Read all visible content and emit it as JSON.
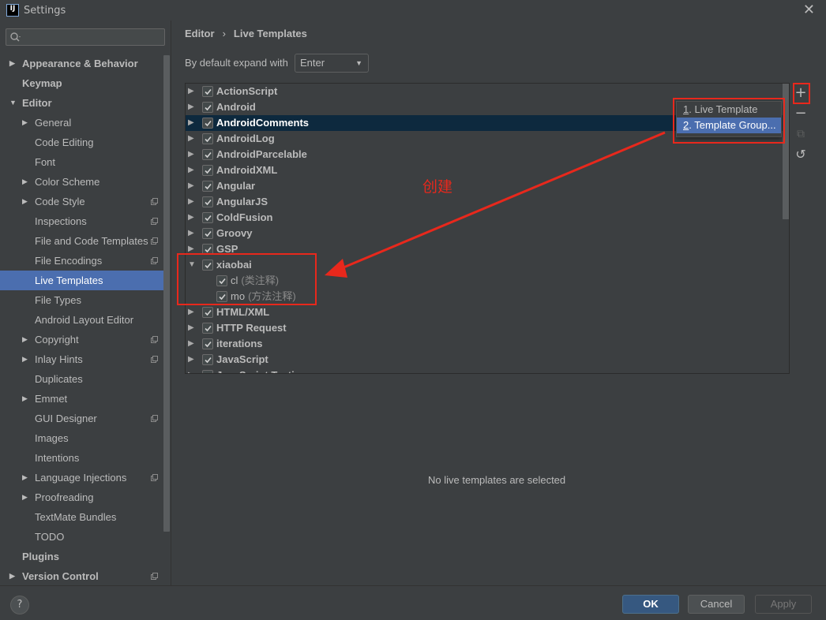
{
  "window": {
    "title": "Settings",
    "logo_text": "IJ"
  },
  "sidebar": {
    "search_placeholder": "",
    "items": [
      {
        "label": "Appearance & Behavior",
        "level": 0,
        "bold": true,
        "arrow": "right",
        "badge": false
      },
      {
        "label": "Keymap",
        "level": 0,
        "bold": true,
        "arrow": "",
        "badge": false
      },
      {
        "label": "Editor",
        "level": 0,
        "bold": true,
        "arrow": "down",
        "badge": false
      },
      {
        "label": "General",
        "level": 1,
        "bold": false,
        "arrow": "right",
        "badge": false
      },
      {
        "label": "Code Editing",
        "level": 1,
        "bold": false,
        "arrow": "",
        "badge": false
      },
      {
        "label": "Font",
        "level": 1,
        "bold": false,
        "arrow": "",
        "badge": false
      },
      {
        "label": "Color Scheme",
        "level": 1,
        "bold": false,
        "arrow": "right",
        "badge": false
      },
      {
        "label": "Code Style",
        "level": 1,
        "bold": false,
        "arrow": "right",
        "badge": true
      },
      {
        "label": "Inspections",
        "level": 1,
        "bold": false,
        "arrow": "",
        "badge": true
      },
      {
        "label": "File and Code Templates",
        "level": 1,
        "bold": false,
        "arrow": "",
        "badge": true
      },
      {
        "label": "File Encodings",
        "level": 1,
        "bold": false,
        "arrow": "",
        "badge": true
      },
      {
        "label": "Live Templates",
        "level": 1,
        "bold": false,
        "arrow": "",
        "badge": false,
        "selected": true
      },
      {
        "label": "File Types",
        "level": 1,
        "bold": false,
        "arrow": "",
        "badge": false
      },
      {
        "label": "Android Layout Editor",
        "level": 1,
        "bold": false,
        "arrow": "",
        "badge": false
      },
      {
        "label": "Copyright",
        "level": 1,
        "bold": false,
        "arrow": "right",
        "badge": true
      },
      {
        "label": "Inlay Hints",
        "level": 1,
        "bold": false,
        "arrow": "right",
        "badge": true
      },
      {
        "label": "Duplicates",
        "level": 1,
        "bold": false,
        "arrow": "",
        "badge": false
      },
      {
        "label": "Emmet",
        "level": 1,
        "bold": false,
        "arrow": "right",
        "badge": false
      },
      {
        "label": "GUI Designer",
        "level": 1,
        "bold": false,
        "arrow": "",
        "badge": true
      },
      {
        "label": "Images",
        "level": 1,
        "bold": false,
        "arrow": "",
        "badge": false
      },
      {
        "label": "Intentions",
        "level": 1,
        "bold": false,
        "arrow": "",
        "badge": false
      },
      {
        "label": "Language Injections",
        "level": 1,
        "bold": false,
        "arrow": "right",
        "badge": true
      },
      {
        "label": "Proofreading",
        "level": 1,
        "bold": false,
        "arrow": "right",
        "badge": false
      },
      {
        "label": "TextMate Bundles",
        "level": 1,
        "bold": false,
        "arrow": "",
        "badge": false
      },
      {
        "label": "TODO",
        "level": 1,
        "bold": false,
        "arrow": "",
        "badge": false
      },
      {
        "label": "Plugins",
        "level": 0,
        "bold": true,
        "arrow": "",
        "badge": false
      },
      {
        "label": "Version Control",
        "level": 0,
        "bold": true,
        "arrow": "right",
        "badge": true
      }
    ]
  },
  "breadcrumb": {
    "parent": "Editor",
    "separator": "›",
    "current": "Live Templates"
  },
  "expand": {
    "label": "By default expand with",
    "value": "Enter"
  },
  "tree": [
    {
      "type": "group",
      "label": "ActionScript",
      "checked": true
    },
    {
      "type": "group",
      "label": "Android",
      "checked": true
    },
    {
      "type": "group",
      "label": "AndroidComments",
      "checked": true,
      "highlighted": true
    },
    {
      "type": "group",
      "label": "AndroidLog",
      "checked": true
    },
    {
      "type": "group",
      "label": "AndroidParcelable",
      "checked": true
    },
    {
      "type": "group",
      "label": "AndroidXML",
      "checked": true
    },
    {
      "type": "group",
      "label": "Angular",
      "checked": true
    },
    {
      "type": "group",
      "label": "AngularJS",
      "checked": true
    },
    {
      "type": "group",
      "label": "ColdFusion",
      "checked": true
    },
    {
      "type": "group",
      "label": "Groovy",
      "checked": true
    },
    {
      "type": "group",
      "label": "GSP",
      "checked": true
    },
    {
      "type": "group",
      "label": "xiaobai",
      "checked": true,
      "expanded": true
    },
    {
      "type": "template",
      "label": "cl",
      "desc": "(类注释)",
      "checked": true
    },
    {
      "type": "template",
      "label": "mo",
      "desc": "(方法注释)",
      "checked": true
    },
    {
      "type": "group",
      "label": "HTML/XML",
      "checked": true
    },
    {
      "type": "group",
      "label": "HTTP Request",
      "checked": true
    },
    {
      "type": "group",
      "label": "iterations",
      "checked": true
    },
    {
      "type": "group",
      "label": "JavaScript",
      "checked": true
    },
    {
      "type": "group",
      "label": "JavaScript Testing",
      "checked": true
    }
  ],
  "toolbar": {
    "add": "+",
    "remove": "−",
    "copy": "⧉",
    "restore": "↺"
  },
  "popup": {
    "items": [
      {
        "mnemonic": "1",
        "rest": ". Live Template",
        "selected": false
      },
      {
        "mnemonic": "2",
        "rest": ". Template Group...",
        "selected": true
      }
    ]
  },
  "annotation": {
    "text": "创建",
    "color": "#e8281c"
  },
  "empty_message": "No live templates are selected",
  "buttons": {
    "help": "?",
    "ok": "OK",
    "cancel": "Cancel",
    "apply": "Apply"
  },
  "colors": {
    "background": "#3c3f41",
    "selection": "#4b6eaf",
    "row_highlight": "#0d293e",
    "annotation": "#e8281c"
  }
}
